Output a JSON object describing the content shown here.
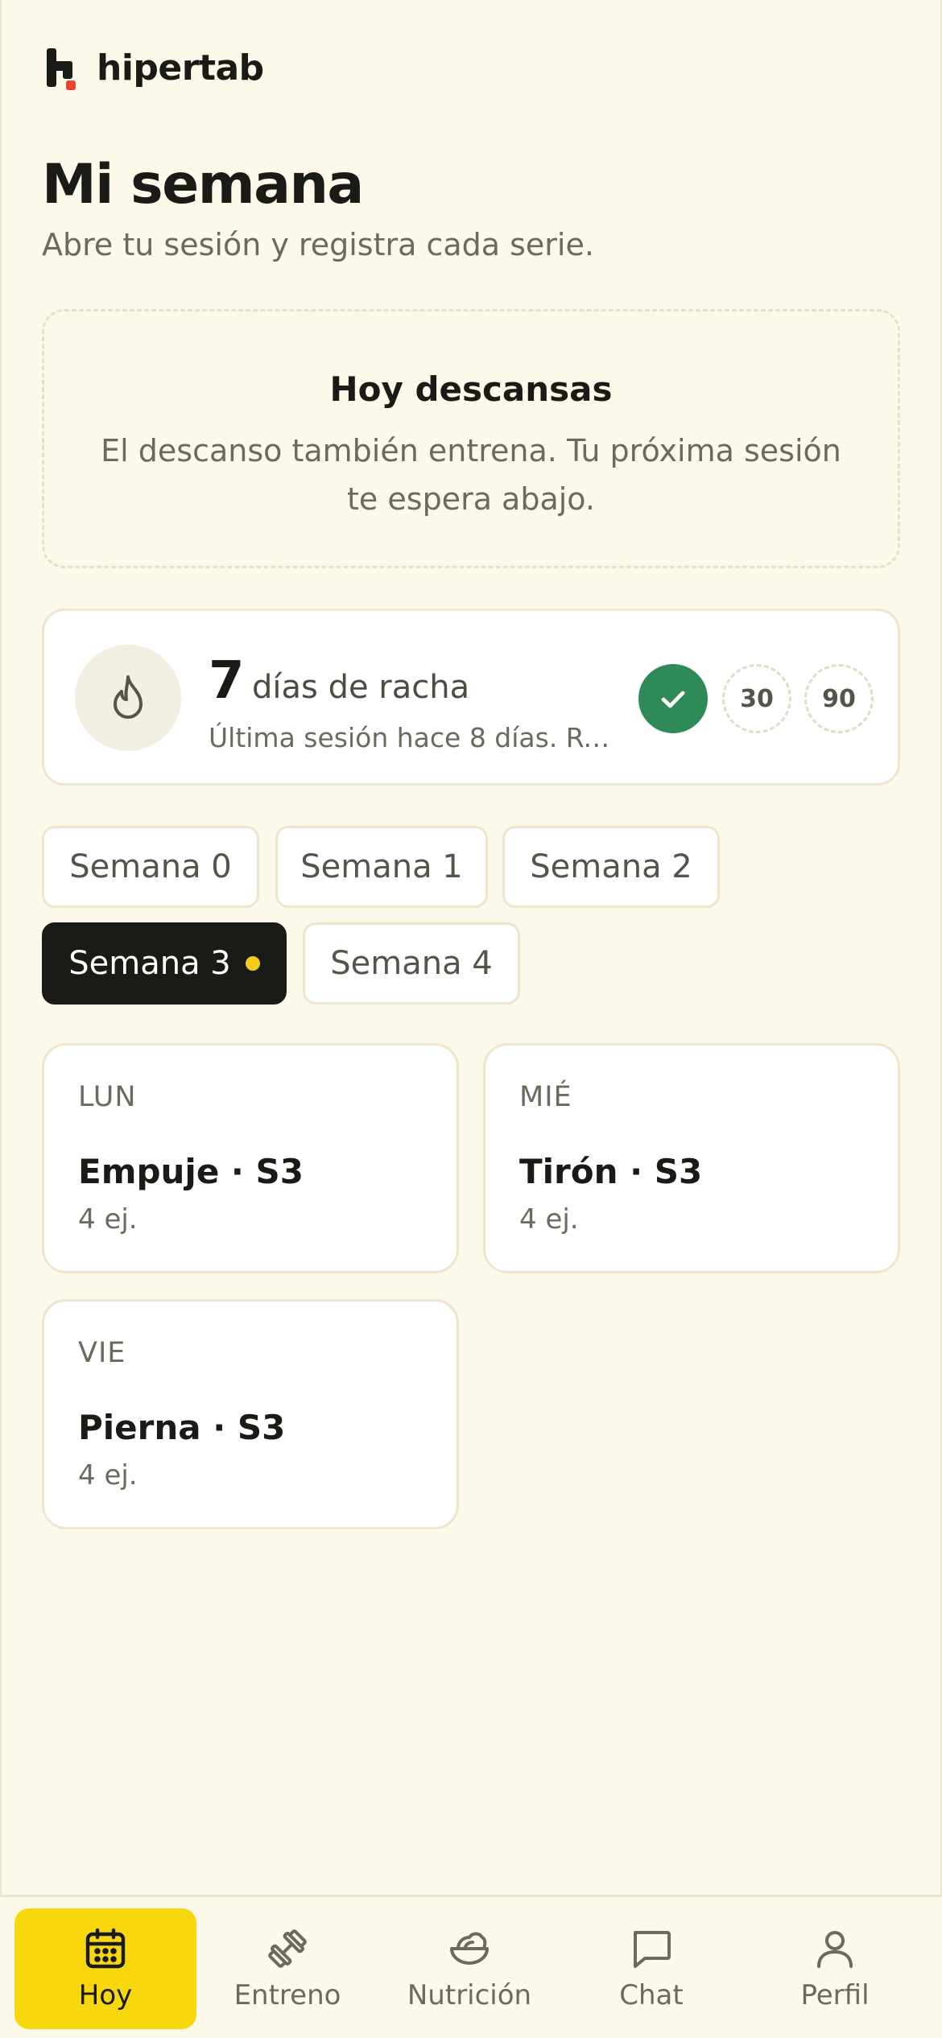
{
  "brand": {
    "name": "hipertab",
    "accent": "#e8462c"
  },
  "header": {
    "title": "Mi semana",
    "subtitle": "Abre tu sesión y registra cada serie."
  },
  "rest": {
    "title": "Hoy descansas",
    "text": "El descanso también entrena. Tu próxima sesión te espera abajo."
  },
  "streak": {
    "icon": "flame-icon",
    "days": "7",
    "label": "días de racha",
    "last_session": "Última sesión hace 8 días. Re…",
    "milestones": [
      {
        "icon": "check-icon",
        "achieved": true,
        "color": "#2e8b57"
      },
      {
        "label": "30",
        "achieved": false
      },
      {
        "label": "90",
        "achieved": false
      }
    ]
  },
  "weeks": [
    {
      "label": "Semana 0",
      "active": false
    },
    {
      "label": "Semana 1",
      "active": false
    },
    {
      "label": "Semana 2",
      "active": false
    },
    {
      "label": "Semana 3",
      "active": true,
      "current_indicator_color": "#f5cc1c"
    },
    {
      "label": "Semana 4",
      "active": false
    }
  ],
  "days": [
    {
      "day": "LUN",
      "name": "Empuje · S3",
      "count": "4 ej."
    },
    {
      "day": "MIÉ",
      "name": "Tirón · S3",
      "count": "4 ej."
    },
    {
      "day": "VIE",
      "name": "Pierna · S3",
      "count": "4 ej."
    }
  ],
  "nav": {
    "active_color": "#f7d80f",
    "items": [
      {
        "label": "Hoy",
        "icon": "calendar-icon",
        "active": true
      },
      {
        "label": "Entreno",
        "icon": "dumbbell-icon",
        "active": false
      },
      {
        "label": "Nutrición",
        "icon": "salad-bowl-icon",
        "active": false
      },
      {
        "label": "Chat",
        "icon": "chat-bubble-icon",
        "active": false
      },
      {
        "label": "Perfil",
        "icon": "user-icon",
        "active": false
      }
    ]
  }
}
